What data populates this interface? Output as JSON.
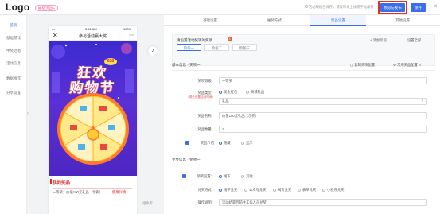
{
  "header": {
    "logo": "Logo",
    "badge": "抽奖活动 •",
    "hint": "活动模板已保存，请及时与上线前手动保存",
    "preview_label": "预览与发布",
    "save_label": "保存"
  },
  "sidebar": {
    "items": [
      {
        "label": "首页"
      },
      {
        "label": "基础游戏"
      },
      {
        "label": "中奖范围"
      },
      {
        "label": "活动信息"
      },
      {
        "label": "数据推荐"
      },
      {
        "label": "分享设置"
      }
    ]
  },
  "phone": {
    "time": "3:21 AM",
    "battery": "100%",
    "title": "参与活动赢大奖",
    "poster_line1": "狂欢",
    "poster_line2": "购物节",
    "tag": "618",
    "my_prize_title": "我的奖品",
    "prize_text": "一等奖：价值100元礼品（示例）",
    "prize_link": "使用详情"
  },
  "widget_label": "组件库",
  "tabs": [
    {
      "label": "基础设置"
    },
    {
      "label": "抽奖方式"
    },
    {
      "label": "奖品设置"
    },
    {
      "label": "其他设置"
    }
  ],
  "info": {
    "title": "请设置活动奖项的奖项",
    "badge": "X",
    "add": "+ 添加阶段",
    "set": "设置全部",
    "stages": [
      "阶段一",
      "阶段二",
      "阶段三"
    ]
  },
  "basic": {
    "section": "基本信息 · 奖项一",
    "copy": "◫ 复制奖项配置",
    "common": "⚙ 常用奖品配置 ∨",
    "name_label": "奖项等级：",
    "name_value": "一等奖",
    "type_label": "奖品类型：",
    "type_sub": "（请先设置活动时间）",
    "type_opt1": "现金红包",
    "type_opt2": "商城礼品",
    "type_select": "礼品",
    "prize_label": "奖品名称：",
    "prize_value": "价值100元礼品（示例）",
    "qty_label": "奖品数量：",
    "qty_value": "1",
    "show_label": "奖品介绍",
    "show_opt1": "隐藏",
    "show_opt2": "显示"
  },
  "claim": {
    "section": "兑奖信息 · 奖项一",
    "method_label": "领奖设置：",
    "method_opt1": "线下",
    "method_opt2": "其他",
    "way_label": "兑奖方式：",
    "ways": [
      "线下兑奖",
      "公众号兑奖",
      "网页兑奖",
      "表单兑奖",
      "小程序兑奖"
    ],
    "desc_label": "操作说明：",
    "desc_value": "活动结束后前往工作人员兑奖"
  }
}
